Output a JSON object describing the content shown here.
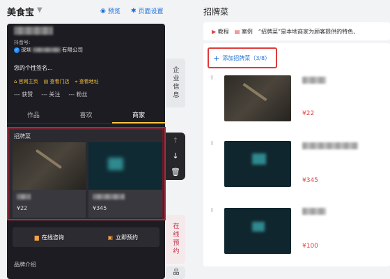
{
  "topbar": {
    "app_title": "美食宝",
    "preview": "预览",
    "page_settings": "页面设置"
  },
  "profile": {
    "douyin_label": "抖音号:",
    "company_prefix": "深圳",
    "company_suffix": "有限公司",
    "signature": "您的个性签名...",
    "badges": [
      "官网主页",
      "查看门店",
      "查看地址"
    ],
    "stats": [
      "--- 获赞",
      "--- 关注",
      "--- 粉丝"
    ],
    "tabs": [
      "作品",
      "喜欢",
      "商家"
    ]
  },
  "signature_section": {
    "title": "招牌菜",
    "items": [
      {
        "price": "¥22"
      },
      {
        "price": "¥345"
      }
    ]
  },
  "actions": {
    "consult": "在线咨询",
    "book": "立即预约"
  },
  "brand_intro": "品牌介绍",
  "side_tabs": [
    "企业信息",
    "在线预约",
    "品"
  ],
  "right_panel": {
    "title": "招牌菜",
    "tutorial": "教程",
    "case": "案例",
    "description": "“招牌菜”是本地商家为顾客提供的特色、",
    "add_label": "添加招牌菜（3/8）",
    "items": [
      {
        "price": "¥22"
      },
      {
        "price": "¥345"
      },
      {
        "price": "¥100"
      }
    ]
  },
  "colors": {
    "accent_blue": "#1f6fd6",
    "highlight_red": "#e03a3a",
    "price_red": "#e04040",
    "badge_yellow": "#f5c142"
  }
}
